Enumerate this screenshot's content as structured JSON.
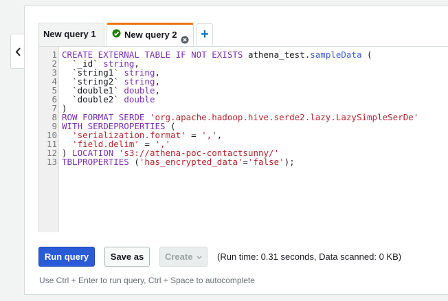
{
  "tabs": [
    {
      "label": "New query 1",
      "active": false
    },
    {
      "label": "New query 2",
      "active": true,
      "status": "check-circle-icon"
    }
  ],
  "add_tab_label": "+",
  "editor": {
    "line_numbers": [
      "1",
      "2",
      "3",
      "4",
      "5",
      "6",
      "7",
      "8",
      "9",
      "10",
      "11",
      "12",
      "13"
    ],
    "lines": [
      [
        {
          "t": "kw",
          "v": "CREATE EXTERNAL TABLE IF NOT EXISTS "
        },
        {
          "t": "bt",
          "v": "athena_test."
        },
        {
          "t": "fn",
          "v": "sampleData"
        },
        {
          "t": "bt",
          "v": " ("
        }
      ],
      [
        {
          "t": "bt",
          "v": "  `_id` "
        },
        {
          "t": "ty",
          "v": "string"
        },
        {
          "t": "bt",
          "v": ","
        }
      ],
      [
        {
          "t": "bt",
          "v": "  `string1` "
        },
        {
          "t": "ty",
          "v": "string"
        },
        {
          "t": "bt",
          "v": ","
        }
      ],
      [
        {
          "t": "bt",
          "v": "  `string2` "
        },
        {
          "t": "ty",
          "v": "string"
        },
        {
          "t": "bt",
          "v": ","
        }
      ],
      [
        {
          "t": "bt",
          "v": "  `double1` "
        },
        {
          "t": "ty",
          "v": "double"
        },
        {
          "t": "bt",
          "v": ","
        }
      ],
      [
        {
          "t": "bt",
          "v": "  `double2` "
        },
        {
          "t": "ty",
          "v": "double"
        }
      ],
      [
        {
          "t": "bt",
          "v": ")"
        }
      ],
      [
        {
          "t": "kw",
          "v": "ROW FORMAT SERDE "
        },
        {
          "t": "str",
          "v": "'org.apache.hadoop.hive.serde2.lazy.LazySimpleSerDe'"
        }
      ],
      [
        {
          "t": "kw",
          "v": "WITH SERDEPROPERTIES"
        },
        {
          "t": "bt",
          "v": " ("
        }
      ],
      [
        {
          "t": "bt",
          "v": "  "
        },
        {
          "t": "str",
          "v": "'serialization.format'"
        },
        {
          "t": "bt",
          "v": " = "
        },
        {
          "t": "str",
          "v": "','"
        },
        {
          "t": "bt",
          "v": ","
        }
      ],
      [
        {
          "t": "bt",
          "v": "  "
        },
        {
          "t": "str",
          "v": "'field.delim'"
        },
        {
          "t": "bt",
          "v": " = "
        },
        {
          "t": "str",
          "v": "','"
        }
      ],
      [
        {
          "t": "bt",
          "v": ") "
        },
        {
          "t": "kw",
          "v": "LOCATION "
        },
        {
          "t": "str",
          "v": "'s3://athena-poc-contactsunny/'"
        }
      ],
      [
        {
          "t": "kw",
          "v": "TBLPROPERTIES"
        },
        {
          "t": "bt",
          "v": " ("
        },
        {
          "t": "str",
          "v": "'has_encrypted_data'"
        },
        {
          "t": "bt",
          "v": "="
        },
        {
          "t": "str",
          "v": "'false'"
        },
        {
          "t": "bt",
          "v": ");"
        }
      ]
    ]
  },
  "buttons": {
    "run": "Run query",
    "save": "Save as",
    "create": "Create"
  },
  "run_info": "(Run time: 0.31 seconds, Data scanned: 0 KB)",
  "hint": "Use Ctrl + Enter to run query, Ctrl + Space to autocomplete",
  "colors": {
    "accent": "#ec7211",
    "primary": "#2a5bd7",
    "link": "#0073bb"
  }
}
